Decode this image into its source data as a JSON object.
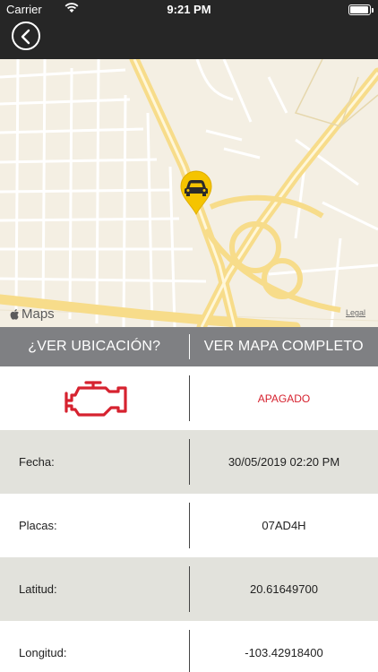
{
  "status_bar": {
    "carrier": "Carrier",
    "time": "9:21 PM"
  },
  "nav": {
    "back_icon": "chevron-left-icon"
  },
  "map": {
    "provider_label": "Maps",
    "legal_label": "Legal",
    "marker_icon": "car-icon"
  },
  "actions": {
    "ver_ubicacion": "¿VER UBICACIÓN?",
    "ver_mapa": "VER MAPA COMPLETO"
  },
  "engine": {
    "icon": "engine-check-icon",
    "status": "APAGADO",
    "status_color": "#d6222f"
  },
  "details": [
    {
      "label": "Fecha:",
      "value": "30/05/2019 02:20 PM"
    },
    {
      "label": "Placas:",
      "value": "07AD4H"
    },
    {
      "label": "Latitud:",
      "value": "20.61649700"
    },
    {
      "label": "Longitud:",
      "value": "-103.42918400"
    }
  ],
  "colors": {
    "header": "#262626",
    "action_bar": "#7f8083",
    "row_shade": "#e2e2dc",
    "marker": "#f5c400"
  }
}
